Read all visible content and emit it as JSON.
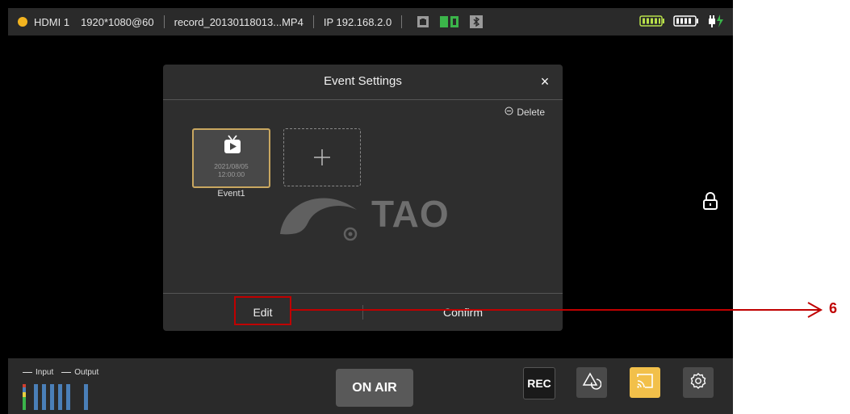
{
  "statusbar": {
    "input_label": "HDMI 1",
    "resolution": "1920*1080@60",
    "file_name": "record_20130118013...MP4",
    "ip": "IP 192.168.2.0",
    "input_dot_color": "#f2b31f"
  },
  "dialog": {
    "title": "Event Settings",
    "close_label": "×",
    "delete_label": "Delete",
    "event": {
      "date_line1": "2021/08/05",
      "date_line2": "12:00:00",
      "name": "Event1"
    },
    "watermark": "TAO",
    "edit_label": "Edit",
    "confirm_label": "Confirm"
  },
  "bottombar": {
    "legend_input": "Input",
    "legend_output": "Output",
    "onair_label": "ON AIR",
    "rec_label": "REC"
  },
  "callout": {
    "number": "6",
    "color": "#c00000"
  },
  "colors": {
    "accent": "#f2c04a",
    "meter": "#4a7fb8"
  }
}
